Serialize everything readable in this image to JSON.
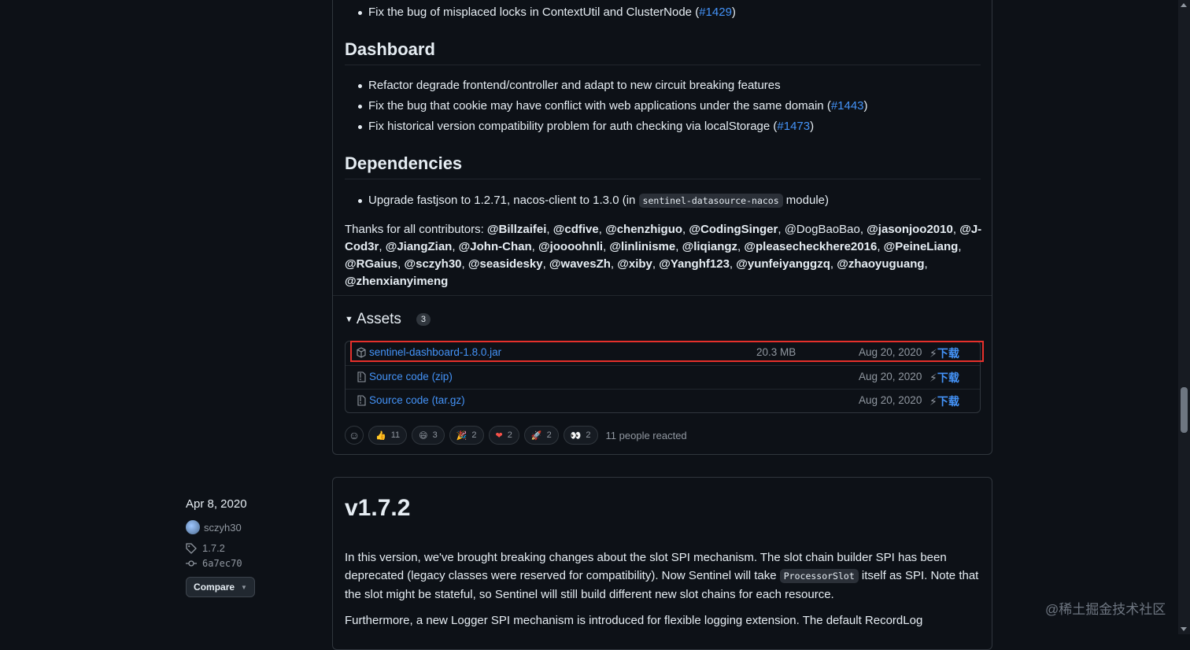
{
  "release_prev": {
    "top_bullet": {
      "text": "Fix the bug of misplaced locks in ContextUtil and ClusterNode (",
      "link": "#1429",
      "tail": ")"
    },
    "dashboard": {
      "heading": "Dashboard",
      "items": [
        {
          "text": "Refactor degrade frontend/controller and adapt to new circuit breaking features",
          "link": "",
          "tail": ""
        },
        {
          "text": "Fix the bug that cookie may have conflict with web applications under the same domain (",
          "link": "#1443",
          "tail": ")"
        },
        {
          "text": "Fix historical version compatibility problem for auth checking via localStorage (",
          "link": "#1473",
          "tail": ")"
        }
      ]
    },
    "dependencies": {
      "heading": "Dependencies",
      "item": {
        "pre": "Upgrade fastjson to 1.2.71, nacos-client to 1.3.0 (in ",
        "code": "sentinel-datasource-nacos",
        "post": " module)"
      }
    },
    "thanks": {
      "prefix": "Thanks for all contributors: ",
      "contributors": [
        {
          "name": "@Billzaifei",
          "bold": true
        },
        {
          "name": "@cdfive",
          "bold": true
        },
        {
          "name": "@chenzhiguo",
          "bold": true
        },
        {
          "name": "@CodingSinger",
          "bold": true
        },
        {
          "name": "@DogBaoBao",
          "bold": false
        },
        {
          "name": "@jasonjoo2010",
          "bold": true
        },
        {
          "name": "@J-Cod3r",
          "bold": true
        },
        {
          "name": "@JiangZian",
          "bold": true
        },
        {
          "name": "@John-Chan",
          "bold": true
        },
        {
          "name": "@joooohnli",
          "bold": true
        },
        {
          "name": "@linlinisme",
          "bold": true
        },
        {
          "name": "@liqiangz",
          "bold": true
        },
        {
          "name": "@pleasecheckhere2016",
          "bold": true
        },
        {
          "name": "@PeineLiang",
          "bold": true
        },
        {
          "name": "@RGaius",
          "bold": true
        },
        {
          "name": "@sczyh30",
          "bold": true
        },
        {
          "name": "@seasidesky",
          "bold": true
        },
        {
          "name": "@wavesZh",
          "bold": true
        },
        {
          "name": "@xiby",
          "bold": true
        },
        {
          "name": "@Yanghf123",
          "bold": true
        },
        {
          "name": "@yunfeiyanggzq",
          "bold": true
        },
        {
          "name": "@zhaoyuguang",
          "bold": true
        },
        {
          "name": "@zhenxianyimeng",
          "bold": true
        }
      ]
    },
    "assets": {
      "title": "Assets",
      "count": "3",
      "rows": [
        {
          "name": "sentinel-dashboard-1.8.0.jar",
          "ext": "",
          "size": "20.3 MB",
          "date": "Aug 20, 2020",
          "download": "下载",
          "icon": "package-icon"
        },
        {
          "name": "Source code ",
          "ext": "(zip)",
          "size": "",
          "date": "Aug 20, 2020",
          "download": "下载",
          "icon": "file-zip-icon"
        },
        {
          "name": "Source code ",
          "ext": "(tar.gz)",
          "size": "",
          "date": "Aug 20, 2020",
          "download": "下载",
          "icon": "file-zip-icon"
        }
      ]
    },
    "reactions": {
      "items": [
        {
          "emoji": "👍",
          "count": "11",
          "name": "thumbs-up"
        },
        {
          "emoji": "😄",
          "count": "3",
          "name": "laugh"
        },
        {
          "emoji": "🎉",
          "count": "2",
          "name": "hooray"
        },
        {
          "emoji": "❤",
          "count": "2",
          "name": "heart"
        },
        {
          "emoji": "🚀",
          "count": "2",
          "name": "rocket"
        },
        {
          "emoji": "👀",
          "count": "2",
          "name": "eyes"
        }
      ],
      "summary": "11 people reacted"
    }
  },
  "release_meta": {
    "date": "Apr 8, 2020",
    "author": "sczyh30",
    "tag": "1.7.2",
    "commit": "6a7ec70",
    "compare_label": "Compare"
  },
  "release_next": {
    "title": "v1.7.2",
    "p1": {
      "pre": "In this version, we've brought breaking changes about the slot SPI mechanism. The slot chain builder SPI has been deprecated (legacy classes were reserved for compatibility). Now Sentinel will take ",
      "code": "ProcessorSlot",
      "post": " itself as SPI. Note that the slot might be stateful, so Sentinel will still build different new slot chains for each resource."
    },
    "p2": "Furthermore, a new Logger SPI mechanism is introduced for flexible logging extension. The default RecordLog"
  },
  "watermark": "@稀土掘金技术社区",
  "colors": {
    "accent": "#4493f8",
    "background": "#0d1117",
    "highlight": "#e5302b"
  }
}
